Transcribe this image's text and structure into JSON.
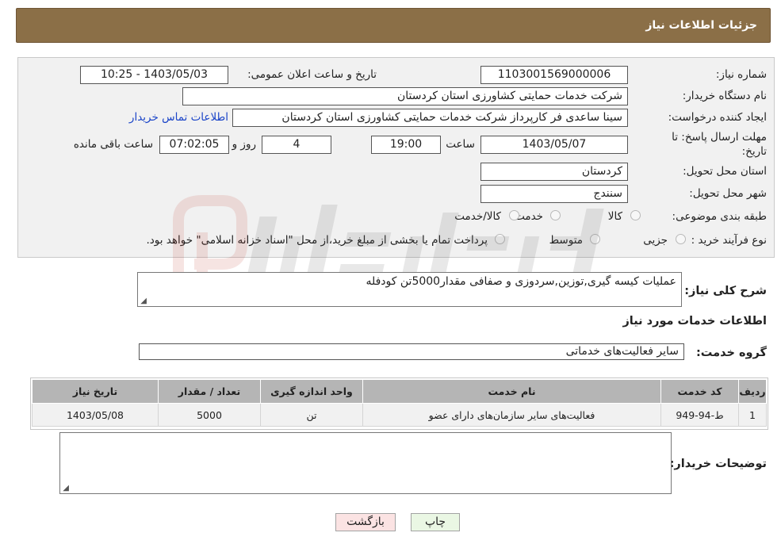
{
  "header": {
    "title": "جزئیات اطلاعات نیاز"
  },
  "form": {
    "need_number_label": "شماره نیاز:",
    "need_number": "1103001569000006",
    "announce_label": "تاریخ و ساعت اعلان عمومی:",
    "announce_value": "1403/05/03 - 10:25",
    "buyer_org_label": "نام دستگاه خریدار:",
    "buyer_org": "شرکت خدمات حمایتی کشاورزی استان کردستان",
    "creator_label": "ایجاد کننده درخواست:",
    "creator": "سینا ساعدی فر کارپرداز شرکت خدمات حمایتی کشاورزی استان کردستان",
    "contact_link": "اطلاعات تماس خریدار",
    "deadline_label_1": "مهلت ارسال پاسخ: تا",
    "deadline_label_2": "تاریخ:",
    "deadline_date": "1403/05/07",
    "time_label": "ساعت",
    "deadline_time": "19:00",
    "days_value": "4",
    "days_label": "روز و",
    "remaining_time": "07:02:05",
    "remaining_label": "ساعت باقی مانده",
    "province_label": "استان محل تحویل:",
    "province": "کردستان",
    "city_label": "شهر محل تحویل:",
    "city": "سنندج",
    "category_label": "طبقه بندی موضوعی:",
    "category_options": [
      "کالا",
      "خدمت",
      "کالا/خدمت"
    ],
    "process_label": "نوع فرآیند خرید :",
    "process_options": [
      "جزیی",
      "متوسط"
    ],
    "process_note": "پرداخت تمام یا بخشی از مبلغ خرید،از محل \"اسناد خزانه اسلامی\" خواهد بود."
  },
  "summary": {
    "label": "شرح کلی نیاز:",
    "value": "عملیات کیسه گیری,توزین,سردوزی و صفافی مقدار5000تن کودفله"
  },
  "services": {
    "section_title": "اطلاعات خدمات مورد نیاز",
    "group_label": "گروه خدمت:",
    "group_value": "سایر فعالیت‌های خدماتی",
    "columns": [
      "ردیف",
      "کد خدمت",
      "نام خدمت",
      "واحد اندازه گیری",
      "تعداد / مقدار",
      "تاریخ نیاز"
    ],
    "rows": [
      [
        "1",
        "ط-94-949",
        "فعالیت‌های سایر سازمان‌های دارای عضو",
        "تن",
        "5000",
        "1403/05/08"
      ]
    ]
  },
  "buyer_notes": {
    "label": "توضیحات خریدار:",
    "value": ""
  },
  "buttons": {
    "print": "چاپ",
    "back": "بازگشت"
  },
  "watermark": {
    "text": "AriaTender.neT"
  },
  "colors": {
    "header_bg": "#8b6f47",
    "link": "#1a44c8",
    "print_btn": "#eaf7e4",
    "back_btn": "#fbe3e3"
  }
}
